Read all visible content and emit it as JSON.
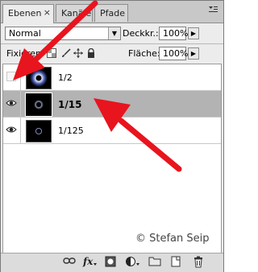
{
  "tabs": [
    {
      "label": "Ebenen",
      "close": "×",
      "active": true
    },
    {
      "label": "Kanäle",
      "active": false
    },
    {
      "label": "Pfade",
      "active": false
    }
  ],
  "blend": {
    "mode": "Normal",
    "arrow": "▼"
  },
  "opacity": {
    "label": "Deckkr.:",
    "value": "100%",
    "arrow": "▶"
  },
  "lock": {
    "label": "Fixieren:",
    "icons": [
      "lock-transparent-icon",
      "brush-icon",
      "move-icon",
      "lock-icon"
    ]
  },
  "fill": {
    "label": "Fläche:",
    "value": "100%",
    "arrow": "▶"
  },
  "layers": [
    {
      "name": "1/2",
      "visible": false,
      "selected": false
    },
    {
      "name": "1/15",
      "visible": true,
      "selected": true
    },
    {
      "name": "1/125",
      "visible": true,
      "selected": false
    }
  ],
  "watermark": "© Stefan Seip",
  "toolbar_icons": [
    "link-icon",
    "fx-icon",
    "mask-icon",
    "adjustment-icon",
    "group-folder-icon",
    "new-layer-icon",
    "trash-icon"
  ],
  "annotation_color": "#e8141e"
}
